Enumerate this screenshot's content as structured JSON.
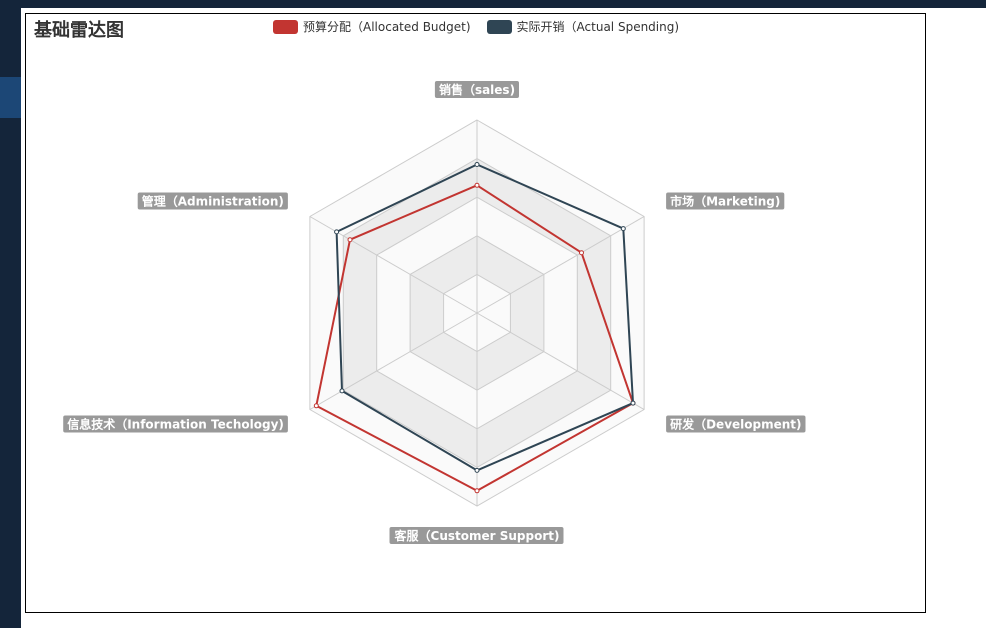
{
  "title": "基础雷达图",
  "legend": [
    {
      "label": "预算分配（Allocated Budget)",
      "color": "#c23531"
    },
    {
      "label": "实际开销（Actual Spending)",
      "color": "#2f4554"
    }
  ],
  "chart_data": {
    "type": "radar",
    "title": "基础雷达图",
    "indicators": [
      {
        "name": "销售（sales)",
        "max": 6500
      },
      {
        "name": "市场（Marketing)",
        "max": 16000
      },
      {
        "name": "研发（Development)",
        "max": 30000
      },
      {
        "name": "客服（Customer Support)",
        "max": 38000
      },
      {
        "name": "信息技术（Information Techology)",
        "max": 52000
      },
      {
        "name": "管理（Administration)",
        "max": 25000
      }
    ],
    "series": [
      {
        "name": "预算分配（Allocated Budget)",
        "color": "#c23531",
        "values": [
          4300,
          10000,
          28000,
          35000,
          50000,
          19000
        ]
      },
      {
        "name": "实际开销（Actual Spending)",
        "color": "#2f4554",
        "values": [
          5000,
          14000,
          28000,
          31000,
          42000,
          21000
        ]
      }
    ],
    "split_number": 5,
    "split_area_colors": [
      "#fafafa",
      "#ececec"
    ],
    "split_line_color": "#cccccc",
    "axis_label_background": "#999999"
  }
}
